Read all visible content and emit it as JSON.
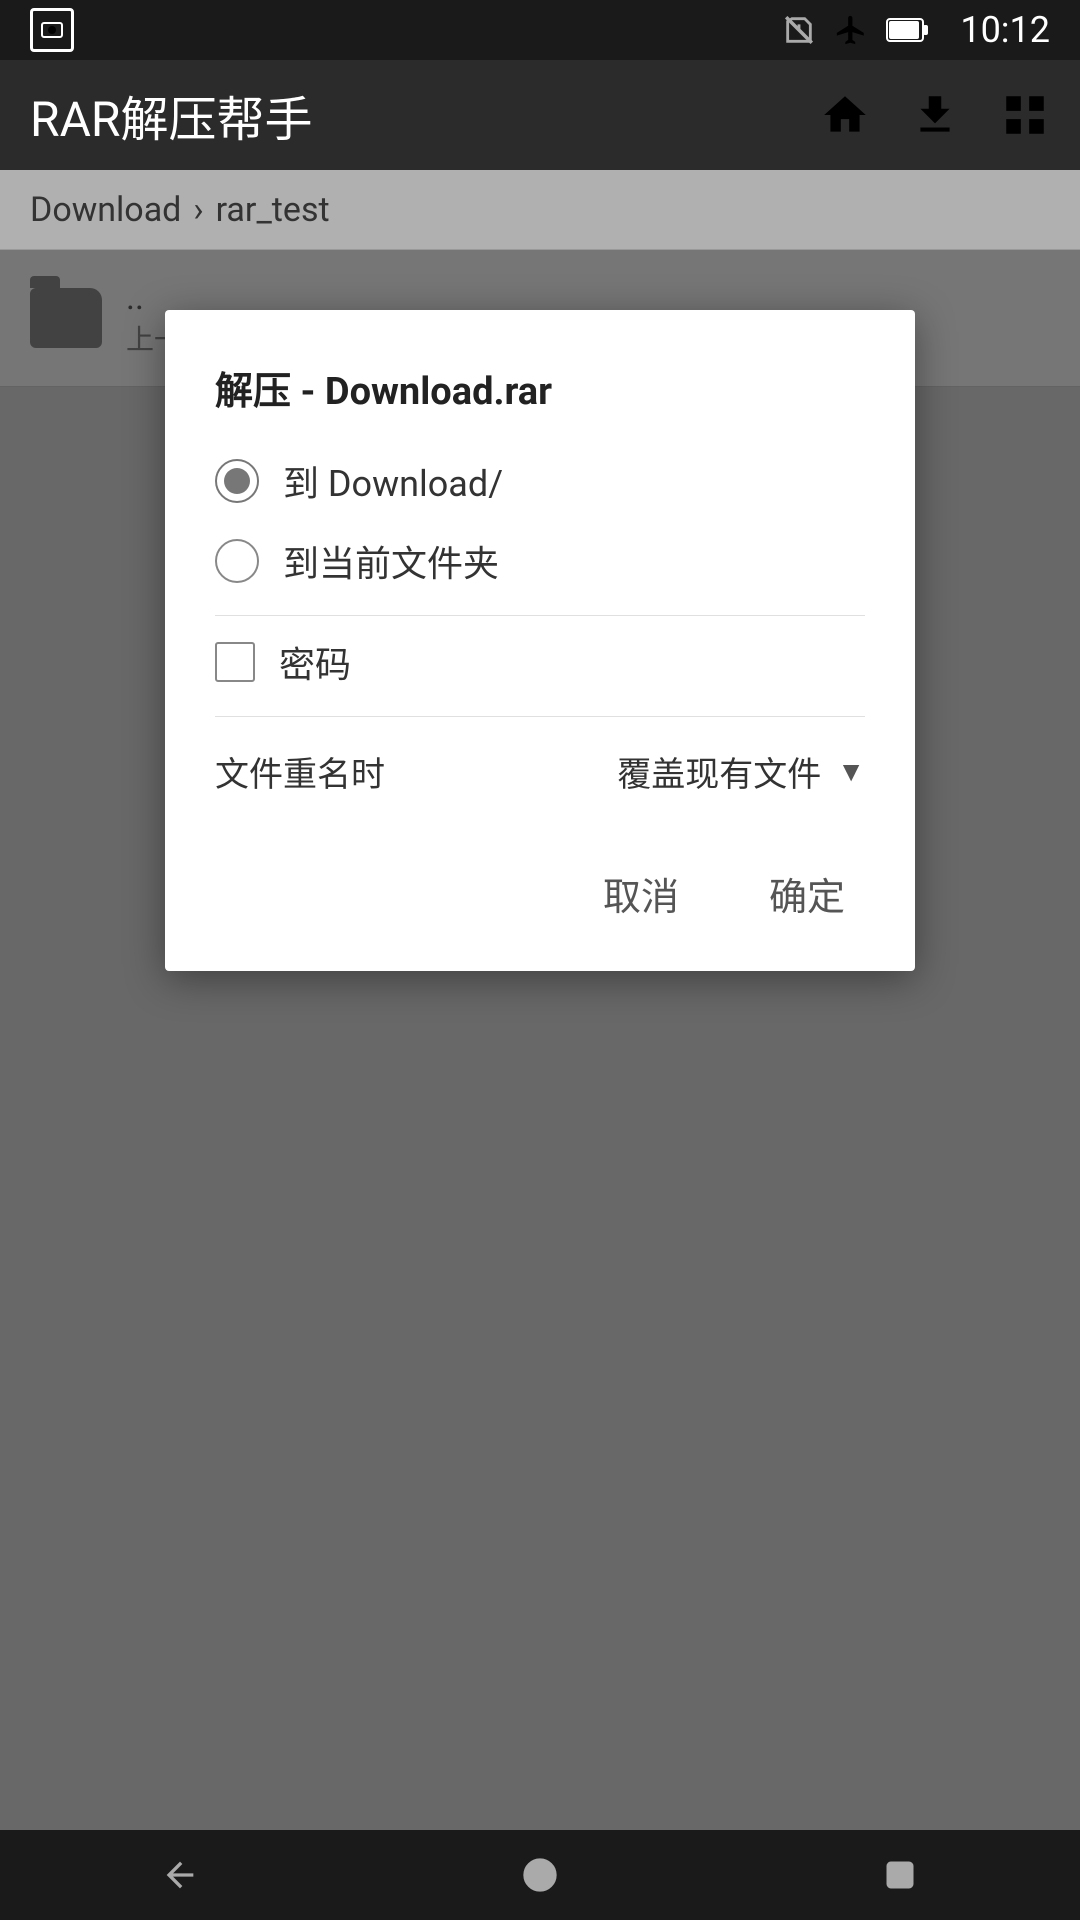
{
  "statusBar": {
    "time": "10:12",
    "batteryIcon": "battery-icon",
    "airplaneIcon": "airplane-icon",
    "simIcon": "sim-icon"
  },
  "appBar": {
    "title": "RAR解压帮手",
    "homeIcon": "home-icon",
    "downloadIcon": "download-icon",
    "gridIcon": "grid-icon"
  },
  "breadcrumb": {
    "part1": "Download",
    "separator": "›",
    "part2": "rar_test"
  },
  "fileList": [
    {
      "type": "folder",
      "name": "..",
      "sublabel": "上一级"
    }
  ],
  "dialog": {
    "title": "解压 - ",
    "titleBold": "Download.rar",
    "option1": "到 Download/",
    "option2": "到当前文件夹",
    "checkboxLabel": "密码",
    "conflictLabel": "文件重名时",
    "conflictValue": "覆盖现有文件",
    "cancelBtn": "取消",
    "confirmBtn": "确定"
  },
  "navBar": {
    "backIcon": "back-icon",
    "homeNavIcon": "home-nav-icon",
    "recentIcon": "recent-icon"
  }
}
